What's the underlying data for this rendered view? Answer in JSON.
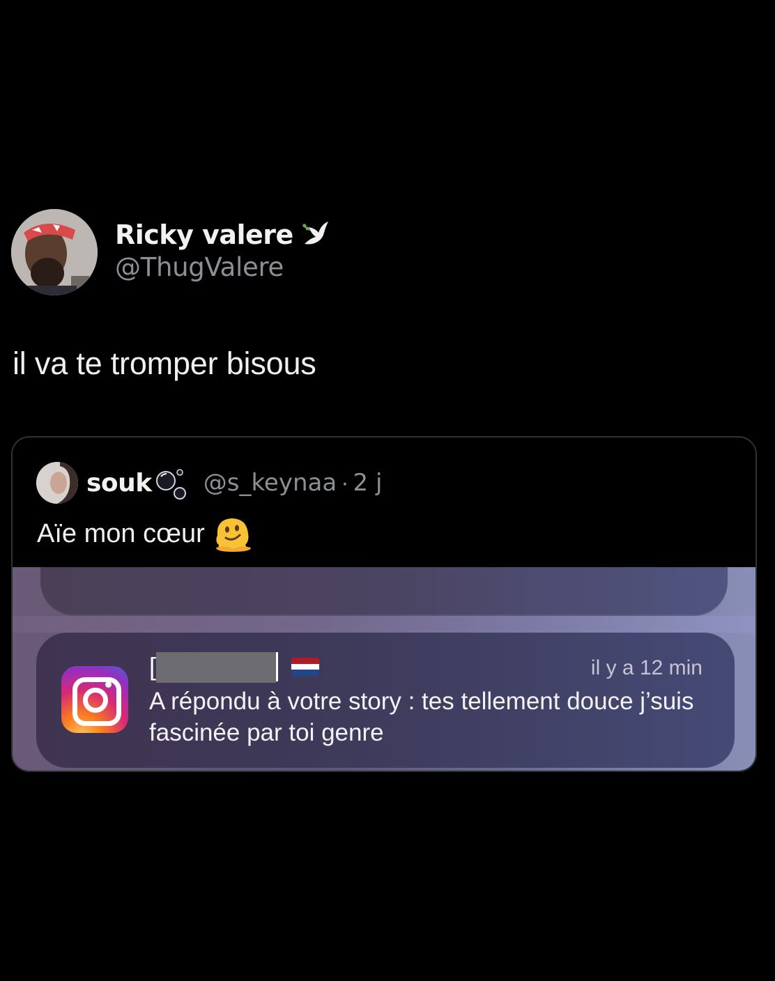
{
  "tweet": {
    "author_name": "Ricky valere",
    "author_handle": "@ThugValere",
    "text": "il va te tromper bisous"
  },
  "quoted_tweet": {
    "author_name": "souk",
    "author_handle": "@s_keynaa",
    "separator": "·",
    "time": "2 j",
    "text": "Aïe mon cœur"
  },
  "notification": {
    "app_icon": "instagram-icon",
    "sender_prefix": "[",
    "flag": "netherlands-flag-icon",
    "time": "il y a 12 min",
    "body": "A répondu à votre story : tes tellement douce j’suis fascinée par toi genre"
  },
  "colors": {
    "background": "#000000",
    "primary_text": "#e7e9ea",
    "secondary_text": "#8b9096",
    "card_border": "#2f3336"
  },
  "icons": [
    "dove-icon",
    "bubbles-icon",
    "melting-face-icon",
    "instagram-icon",
    "netherlands-flag-icon"
  ]
}
